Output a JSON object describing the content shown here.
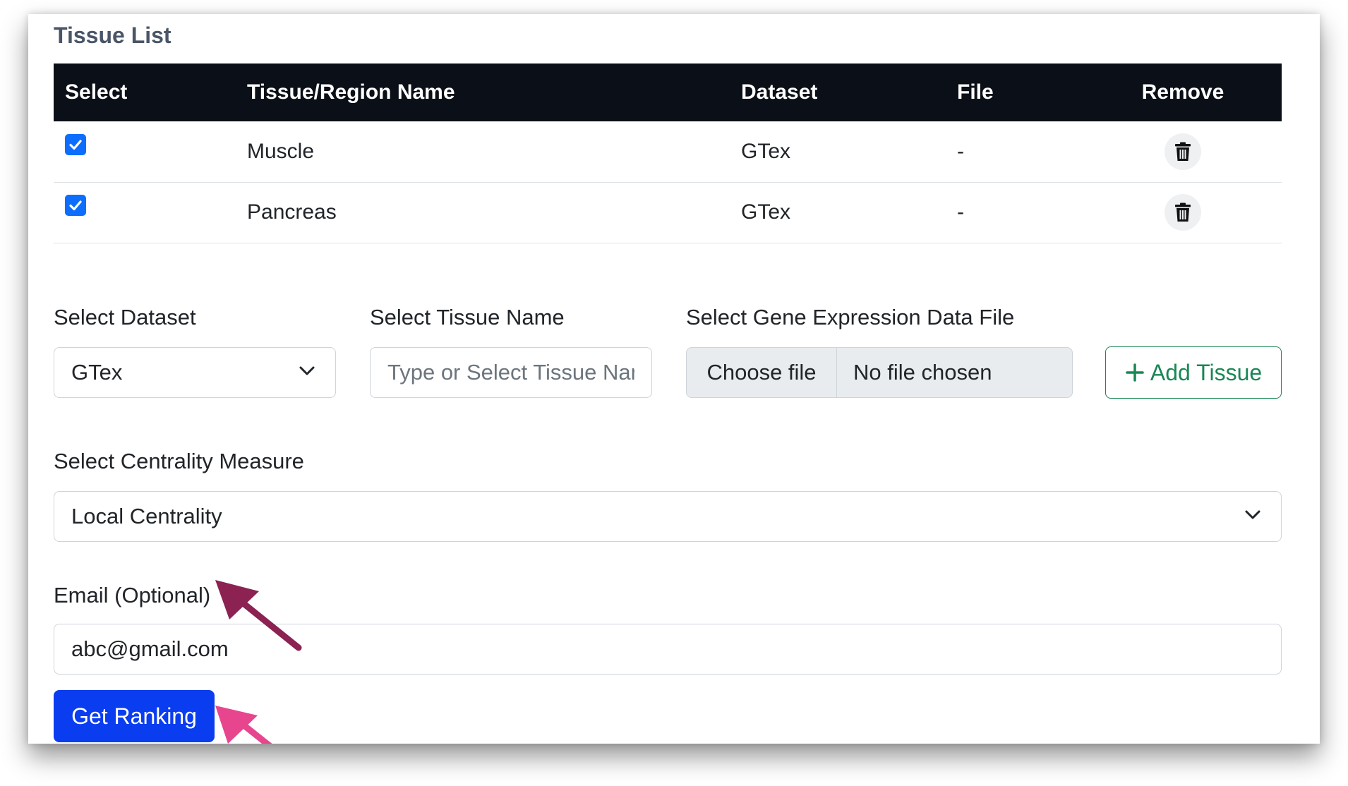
{
  "tissue_list": {
    "title": "Tissue List",
    "columns": [
      "Select",
      "Tissue/Region Name",
      "Dataset",
      "File",
      "Remove"
    ],
    "rows": [
      {
        "selected": true,
        "name": "Muscle",
        "dataset": "GTex",
        "file": "-"
      },
      {
        "selected": true,
        "name": "Pancreas",
        "dataset": "GTex",
        "file": "-"
      }
    ]
  },
  "form": {
    "dataset_label": "Select Dataset",
    "dataset_value": "GTex",
    "tissue_label": "Select Tissue Name",
    "tissue_placeholder": "Type or Select Tissue Name",
    "file_label": "Select Gene Expression Data File",
    "file_button": "Choose file",
    "file_status": "No file chosen",
    "add_tissue": "Add Tissue",
    "centrality_label": "Select Centrality Measure",
    "centrality_value": "Local Centrality",
    "email_label": "Email (Optional)",
    "email_value": "abc@gmail.com",
    "submit": "Get Ranking"
  },
  "colors": {
    "header_bg": "#0b0f17",
    "checkbox": "#0d6efd",
    "add_button": "#198754",
    "primary_button": "#0a3df0",
    "arrow_email": "#8b2252",
    "arrow_button": "#e8458f"
  },
  "icons": {
    "checkbox": "check-icon",
    "remove": "trash-icon",
    "dropdown": "chevron-down-icon",
    "add": "plus-icon",
    "annotation": "arrow-icon"
  }
}
